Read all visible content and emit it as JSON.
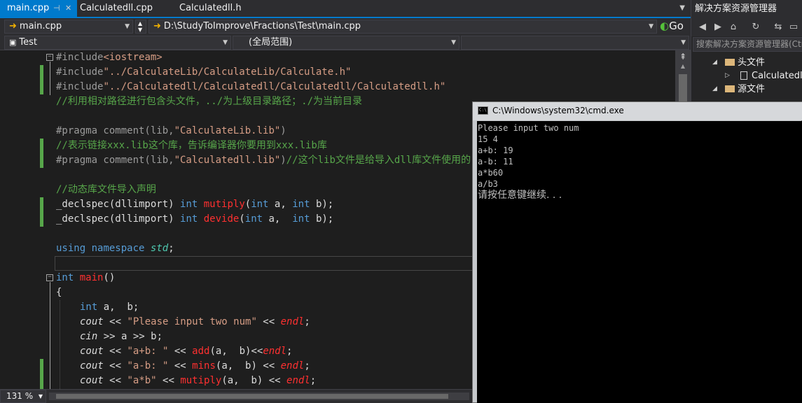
{
  "editor": {
    "tabs": [
      {
        "label": "main.cpp",
        "active": true,
        "pin_icon": "pin-icon",
        "close_icon": "close-icon"
      },
      {
        "label": "Calculatedll.cpp",
        "active": false
      },
      {
        "label": "Calculatedll.h",
        "active": false
      }
    ],
    "nav": {
      "file_combo": "main.cpp",
      "path_combo": "D:\\StudyToImprove\\Fractions\\Test\\main.cpp",
      "go_label": "Go",
      "project_combo": "Test",
      "scope_combo": "(全局范围)"
    },
    "zoom": "131 %",
    "code": {
      "l1": {
        "a": "#include",
        "b": "<iostream>"
      },
      "l2": {
        "a": "#include",
        "b": "\"../CalculateLib/CalculateLib/Calculate.h\""
      },
      "l3": {
        "a": "#include",
        "b": "\"../Calculatedll/Calculatedll/Calculatedll/Calculatedll.h\""
      },
      "l4": "//利用相对路径进行包含头文件，../为上级目录路径；./为当前目录",
      "l6": {
        "a": "#pragma comment(lib,",
        "b": "\"CalculateLib.lib\"",
        "c": ")"
      },
      "l7": "//表示链接xxx.lib这个库，告诉编译器你要用到xxx.lib库",
      "l8": {
        "a": "#pragma comment(lib,",
        "b": "\"Calculatedll.lib\"",
        "c": ")",
        "d": "//这个lib文件是给导入dll库文件使用的"
      },
      "l10": "//动态库文件导入声明",
      "l11": {
        "a": "_declspec(dllimport) ",
        "b": "int",
        "c": " ",
        "d": "mutiply",
        "e": "(",
        "f": "int",
        "g": " a, ",
        "h": "int",
        "i": " b);"
      },
      "l12": {
        "a": "_declspec(dllimport) ",
        "b": "int",
        "c": " ",
        "d": "devide",
        "e": "(",
        "f": "int",
        "g": " a,  ",
        "h": "int",
        "i": " b);"
      },
      "l14": {
        "a": "using",
        "b": " ",
        "c": "namespace",
        "d": " ",
        "e": "std",
        "f": ";"
      },
      "l16": {
        "a": "int",
        "b": " ",
        "c": "main",
        "d": "()"
      },
      "l17": "{",
      "l18": {
        "a": "int",
        "b": " a,  b;"
      },
      "l19": {
        "a": "cout",
        "b": " << ",
        "c": "\"Please input two num\"",
        "d": " << ",
        "e": "endl",
        "f": ";"
      },
      "l20": {
        "a": "cin",
        "b": " >> a >> b;"
      },
      "l21": {
        "a": "cout",
        "b": " << ",
        "c": "\"a+b: \"",
        "d": " << ",
        "e": "add",
        "f": "(a,  b)<<",
        "g": "endl",
        "h": ";"
      },
      "l22": {
        "a": "cout",
        "b": " << ",
        "c": "\"a-b: \"",
        "d": " << ",
        "e": "mins",
        "f": "(a,  b) << ",
        "g": "endl",
        "h": ";"
      },
      "l23": {
        "a": "cout",
        "b": " << ",
        "c": "\"a*b\"",
        "d": " << ",
        "e": "mutiply",
        "f": "(a,  b) << ",
        "g": "endl",
        "h": ";"
      }
    }
  },
  "solution_explorer": {
    "title": "解决方案资源管理器",
    "search_placeholder": "搜索解决方案资源管理器(Ctrl",
    "items": [
      {
        "label": "头文件",
        "type": "folder"
      },
      {
        "label": "Calculatedll.h",
        "type": "file"
      },
      {
        "label": "源文件",
        "type": "folder"
      }
    ],
    "tools": [
      "back-icon",
      "forward-icon",
      "home-icon",
      "history-icon",
      "sync-icon",
      "collapse-icon"
    ]
  },
  "console": {
    "title": "C:\\Windows\\system32\\cmd.exe",
    "lines": [
      "Please input two num",
      "15 4",
      "a+b: 19",
      "a-b: 11",
      "a*b60",
      "a/b3",
      "请按任意键继续. . ."
    ]
  },
  "colors": {
    "editor_bg": "#1e1e1e",
    "accent": "#007acc",
    "comment": "#57a64a",
    "string": "#d69d85",
    "keyword": "#569cd6",
    "function": "#ff3030",
    "console_bg": "#000000"
  }
}
